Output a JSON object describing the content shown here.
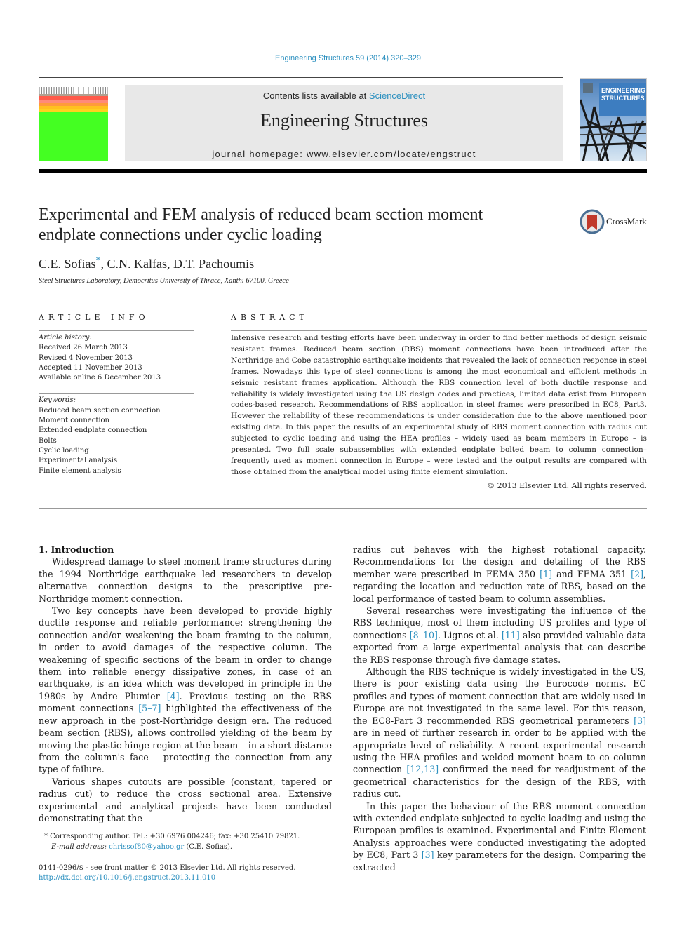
{
  "header": {
    "journal_ref": "Engineering Structures 59 (2014) 320–329",
    "contents_prefix": "Contents lists available at ",
    "contents_link": "ScienceDirect",
    "journal_title": "Engineering Structures",
    "homepage": "journal homepage: www.elsevier.com/locate/engstruct",
    "cover_title_line1": "ENGINEERING",
    "cover_title_line2": "STRUCTURES",
    "crossmark_label": "CrossMark"
  },
  "article": {
    "title": "Experimental and FEM analysis of reduced beam section moment endplate connections under cyclic loading",
    "author1": "C.E. Sofias",
    "author_star": "*",
    "authors_rest": ", C.N. Kalfas, D.T. Pachoumis",
    "affiliation": "Steel Structures Laboratory, Democritus University of Thrace, Xanthi 67100, Greece"
  },
  "article_info": {
    "heading": "ARTICLE INFO",
    "history_label": "Article history:",
    "history": [
      "Received 26 March 2013",
      "Revised 4 November 2013",
      "Accepted 11 November 2013",
      "Available online 6 December 2013"
    ],
    "keywords_label": "Keywords:",
    "keywords": [
      "Reduced beam section connection",
      "Moment connection",
      "Extended endplate connection",
      "Bolts",
      "Cyclic loading",
      "Experimental analysis",
      "Finite element analysis"
    ]
  },
  "abstract": {
    "heading": "ABSTRACT",
    "text": "Intensive research and testing efforts have been underway in order to find better methods of design seismic resistant frames. Reduced beam section (RBS) moment connections have been introduced after the Northridge and Cobe catastrophic earthquake incidents that revealed the lack of connection response in steel frames. Nowadays this type of steel connections is among the most economical and efficient methods in seismic resistant frames application. Although the RBS connection level of both ductile response and reliability is widely investigated using the US design codes and practices, limited data exist from European codes-based research. Recommendations of RBS application in steel frames were prescribed in EC8, Part3. However the reliability of these recommendations is under consideration due to the above mentioned poor existing data. In this paper the results of an experimental study of RBS moment connection with radius cut subjected to cyclic loading and using the HEA profiles – widely used as beam members in Europe – is presented. Two full scale subassemblies with extended endplate bolted beam to column connection– frequently used as moment connection in Europe – were tested and the output results are compared with those obtained from the analytical model using finite element simulation.",
    "copyright": "© 2013 Elsevier Ltd. All rights reserved."
  },
  "body": {
    "section_heading": "1. Introduction",
    "p1": "Widespread damage to steel moment frame structures during the 1994 Northridge earthquake led researchers to develop alternative connection designs to the prescriptive pre-Northridge moment connection.",
    "p2_a": "Two key concepts have been developed to provide highly ductile response and reliable performance: strengthening the connection and/or weakening the beam framing to the column, in order to avoid damages of the respective column. The weakening of specific sections of the beam in order to change them into reliable energy dissipative zones, in case of an earthquake, is an idea which was developed in principle in the 1980s by Andre Plumier ",
    "p2_ref1": "[4]",
    "p2_b": ". Previous testing on the RBS moment connections ",
    "p2_ref2": "[5–7]",
    "p2_c": " highlighted the effectiveness of the new approach in the post-Northridge design era. The reduced beam section (RBS), allows controlled yielding of the beam by moving the plastic hinge region at the beam – in a short distance from the column's face – protecting the connection from any type of failure.",
    "p3": "Various shapes cutouts are possible (constant, tapered or radius cut) to reduce the cross sectional area. Extensive experimental and analytical projects have been conducted demonstrating that the",
    "r1_a": "radius cut behaves with the highest rotational capacity. Recommendations for the design and detailing of the RBS member were prescribed in FEMA 350 ",
    "r1_ref1": "[1]",
    "r1_b": " and FEMA 351 ",
    "r1_ref2": "[2]",
    "r1_c": ", regarding the location and reduction rate of RBS, based on the local performance of tested beam to column assemblies.",
    "r2_a": "Several researches were investigating the influence of the RBS technique, most of them including US profiles and type of connections ",
    "r2_ref1": "[8–10]",
    "r2_b": ". Lignos et al. ",
    "r2_ref2": "[11]",
    "r2_c": " also provided valuable data exported from a large experimental analysis that can describe the RBS response through five damage states.",
    "r3_a": "Although the RBS technique is widely investigated in the US, there is poor existing data using the Eurocode norms. EC profiles and types of moment connection that are widely used in Europe are not investigated in the same level. For this reason, the EC8-Part 3 recommended RBS geometrical parameters ",
    "r3_ref1": "[3]",
    "r3_b": " are in need of further research in order to be applied with the appropriate level of reliability. A recent experimental research using the HEA profiles and welded moment beam to co column connection ",
    "r3_ref2": "[12,13]",
    "r3_c": " confirmed the need for readjustment of the geometrical characteristics for the design of the RBS, with radius cut.",
    "r4_a": "In this paper the behaviour of the RBS moment connection with extended endplate subjected to cyclic loading and using the European profiles is examined. Experimental and Finite Element Analysis approaches were conducted investigating the adopted by EC8, Part 3 ",
    "r4_ref1": "[3]",
    "r4_b": " key parameters for the design. Comparing the extracted"
  },
  "footnote": {
    "star": "*",
    "line1": " Corresponding author. Tel.: +30 6976 004246; fax: +30 25410 79821.",
    "email_label": "E-mail address: ",
    "email": "chrissof80@yahoo.gr",
    "email_suffix": " (C.E. Sofias).",
    "issn": "0141-0296/$ - see front matter © 2013 Elsevier Ltd. All rights reserved.",
    "doi": "http://dx.doi.org/10.1016/j.engstruct.2013.11.010"
  }
}
